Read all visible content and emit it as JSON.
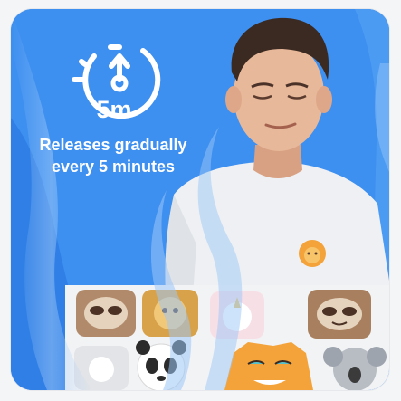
{
  "timer": {
    "value_label": "5m",
    "icon": "clock-arrow-up-icon"
  },
  "headline": {
    "line1": "Releases gradually",
    "line2": "every 5 minutes"
  },
  "colors": {
    "card_blue": "#3d8ff0",
    "wave_light": "#7fb6f6",
    "shirt": "#eef0f3",
    "skin": "#e8b89a",
    "hair": "#3b2a22",
    "sticker_orange": "#f3a33a"
  },
  "stickers": {
    "shirt_sticker": "lion-sticker-icon",
    "sheet": [
      "sloth-sticker-icon",
      "lion-sticker-icon",
      "unicorn-sticker-icon",
      "sloth-sticker-icon",
      "panda-sticker-icon",
      "tiger-sticker-icon",
      "koala-sticker-icon"
    ]
  }
}
